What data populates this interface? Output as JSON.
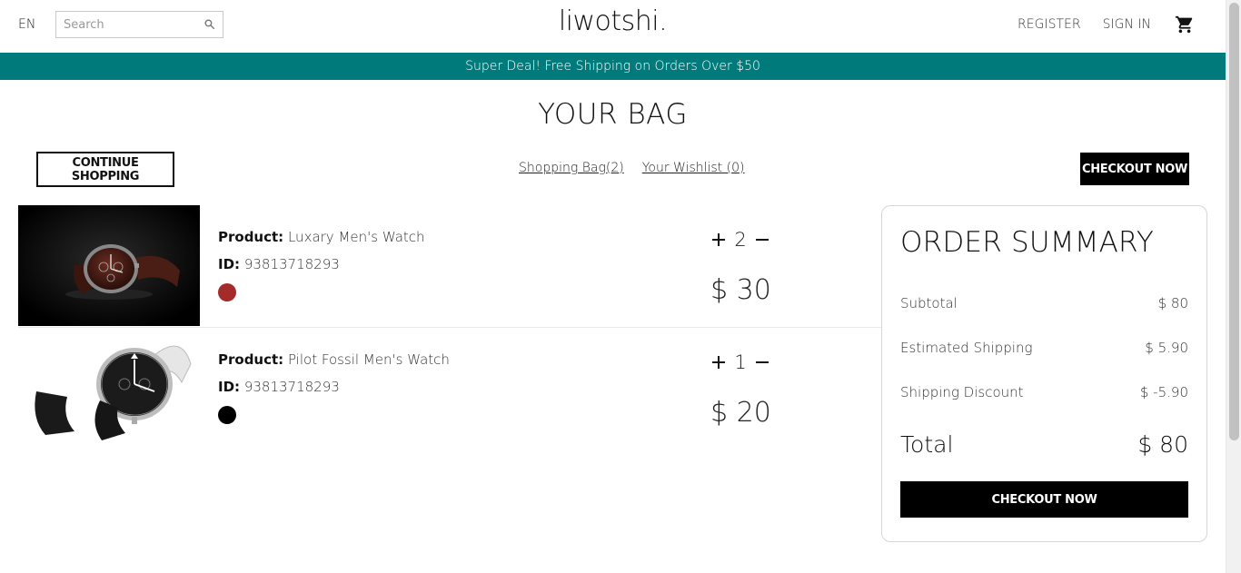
{
  "nav": {
    "language": "EN",
    "search_placeholder": "Search",
    "logo": "liwotshi.",
    "register": "REGISTER",
    "sign_in": "SIGN IN",
    "cart_icon": "shopping-cart-icon",
    "search_icon": "magnifier-icon"
  },
  "announcement": "Super Deal! Free Shipping on Orders Over $50",
  "bag": {
    "title": "YOUR BAG",
    "continue_label": "CONTINUE SHOPPING",
    "shopping_bag_link": "Shopping Bag(2)",
    "wishlist_link": "Your Wishlist (0)",
    "checkout_label": "CHECKOUT NOW"
  },
  "products": [
    {
      "product_label": "Product:",
      "name": "Luxary Men's Watch",
      "id_label": "ID:",
      "id": "93813718293",
      "color": "#a52a2a",
      "quantity": "2",
      "price": "$ 30"
    },
    {
      "product_label": "Product:",
      "name": "Pilot Fossil Men's Watch",
      "id_label": "ID:",
      "id": "93813718293",
      "color": "#000000",
      "quantity": "1",
      "price": "$ 20"
    }
  ],
  "summary": {
    "title": "ORDER SUMMARY",
    "subtotal_label": "Subtotal",
    "subtotal_value": "$ 80",
    "shipping_label": "Estimated Shipping",
    "shipping_value": "$ 5.90",
    "discount_label": "Shipping Discount",
    "discount_value": "$ -5.90",
    "total_label": "Total",
    "total_value": "$ 80",
    "checkout_label": "CHECKOUT NOW"
  },
  "colors": {
    "accent": "#007a7a",
    "button": "#000000"
  }
}
